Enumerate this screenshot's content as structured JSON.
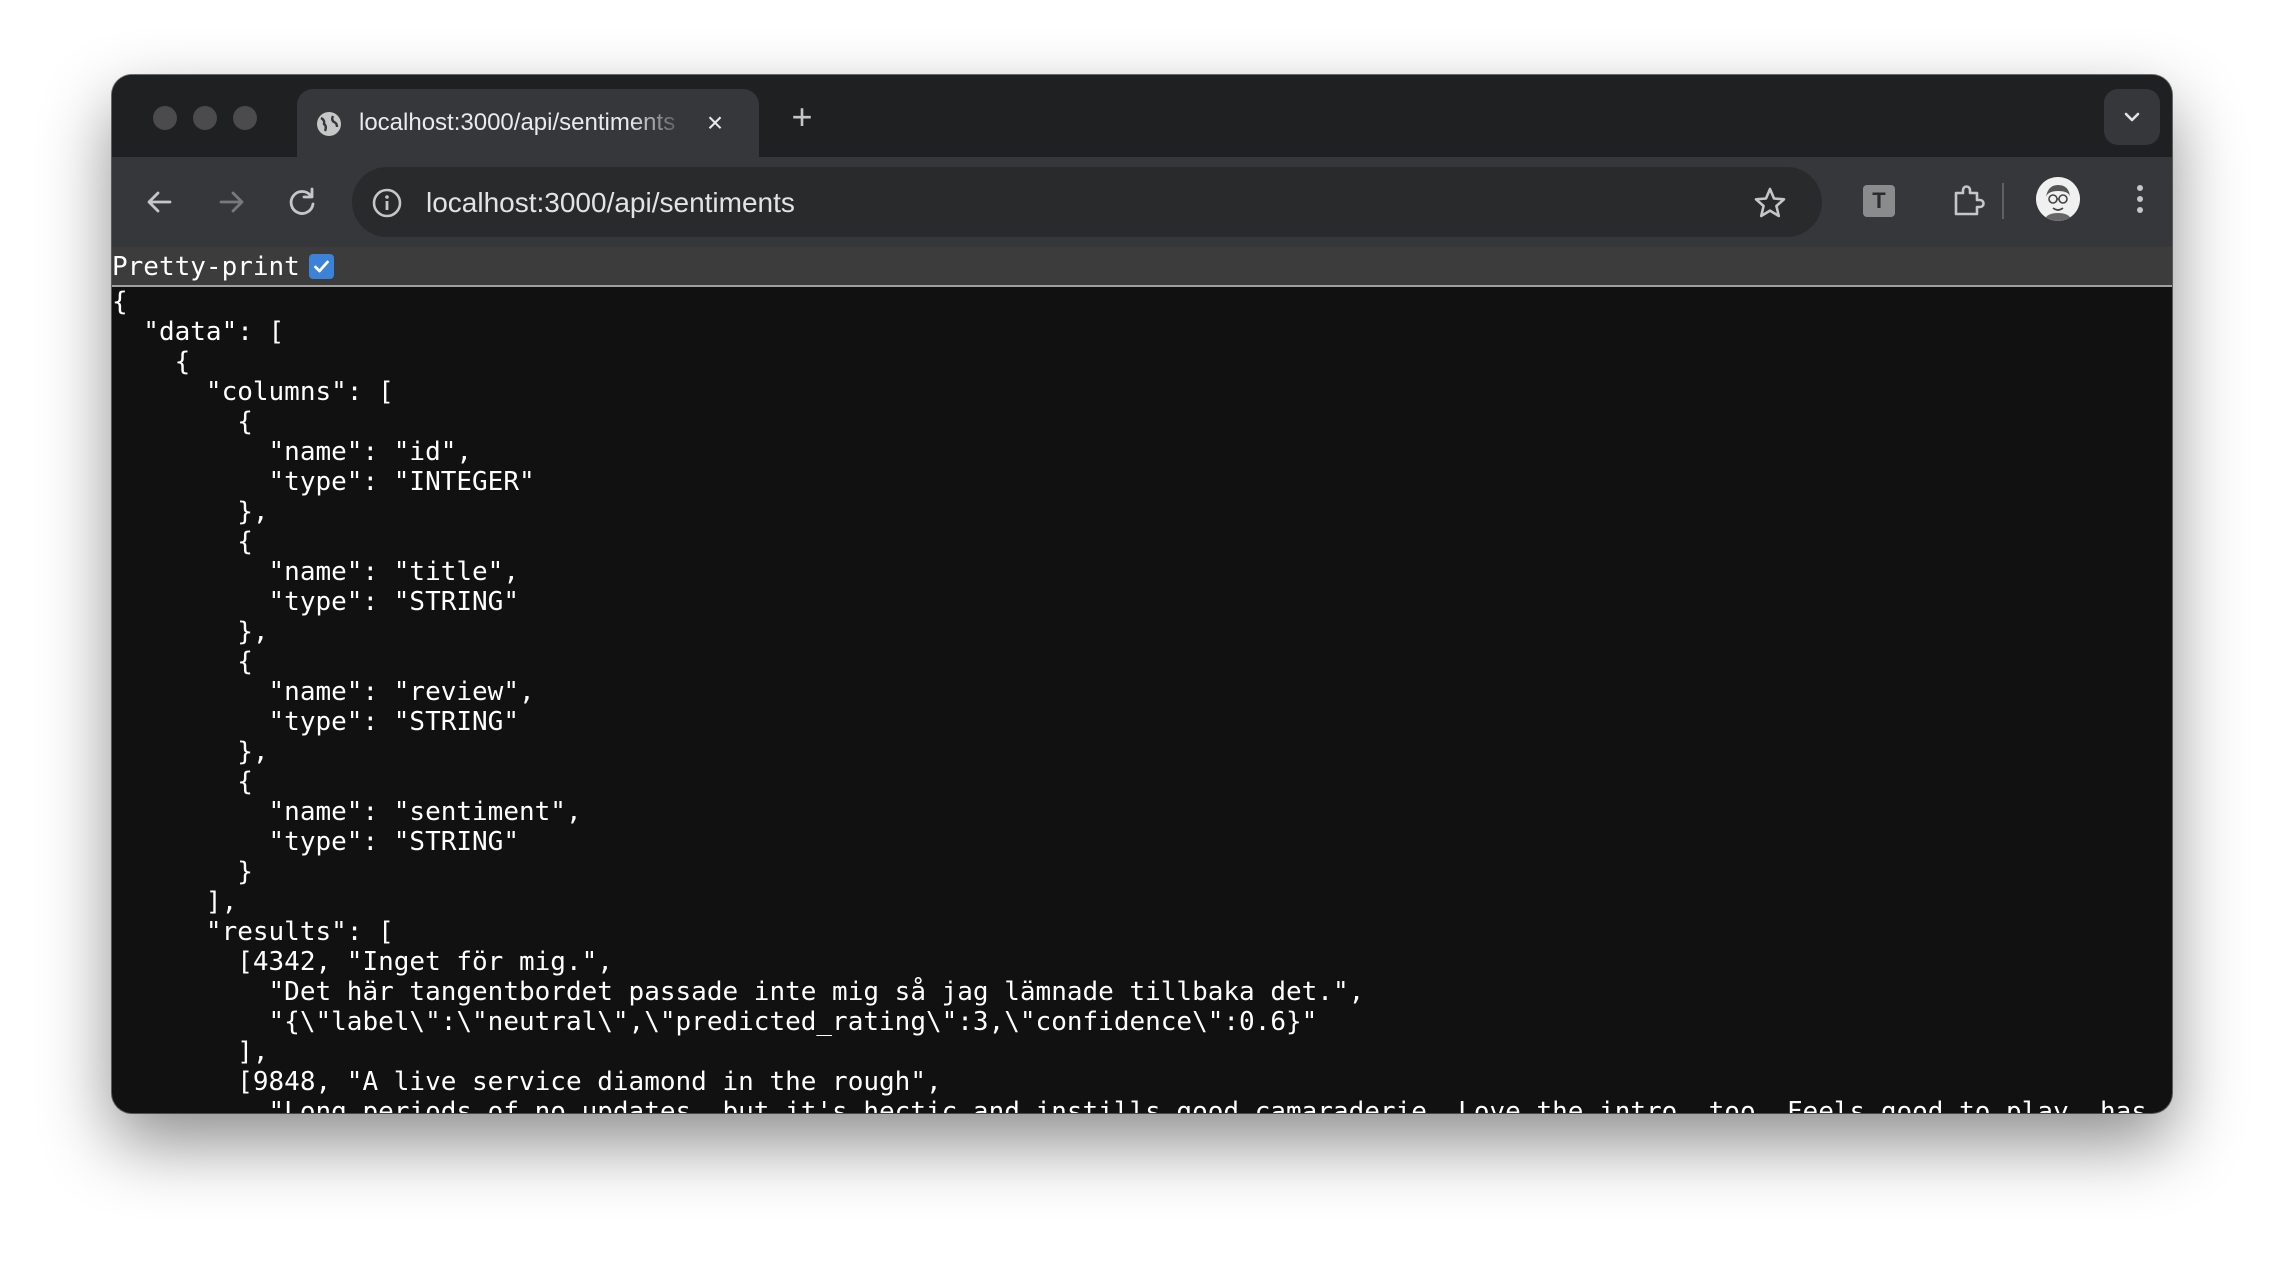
{
  "browser": {
    "tab": {
      "title": "localhost:3000/api/sentiments",
      "close_glyph": "×"
    },
    "new_tab_glyph": "+",
    "omnibox": {
      "url": "localhost:3000/api/sentiments"
    },
    "extension_t_label": "T",
    "icons": [
      "globe-icon",
      "close-icon",
      "plus-icon",
      "chevron-down-icon",
      "back-arrow-icon",
      "forward-arrow-icon",
      "reload-icon",
      "info-icon",
      "star-icon",
      "puzzle-icon",
      "avatar",
      "more-vert-icon",
      "checkbox-check-icon"
    ]
  },
  "pretty_print": {
    "label": "Pretty-print",
    "checked": true
  },
  "json_lines": [
    "{",
    "  \"data\": [",
    "    {",
    "      \"columns\": [",
    "        {",
    "          \"name\": \"id\",",
    "          \"type\": \"INTEGER\"",
    "        },",
    "        {",
    "          \"name\": \"title\",",
    "          \"type\": \"STRING\"",
    "        },",
    "        {",
    "          \"name\": \"review\",",
    "          \"type\": \"STRING\"",
    "        },",
    "        {",
    "          \"name\": \"sentiment\",",
    "          \"type\": \"STRING\"",
    "        }",
    "      ],",
    "      \"results\": [",
    "        [4342, \"Inget för mig.\",",
    "          \"Det här tangentbordet passade inte mig så jag lämnade tillbaka det.\",",
    "          \"{\\\"label\\\":\\\"neutral\\\",\\\"predicted_rating\\\":3,\\\"confidence\\\":0.6}\"",
    "        ],",
    "        [9848, \"A live service diamond in the rough\",",
    "          \"Long periods of no updates, but it's hectic and instills good camaraderie. Love the intro, too. Feels good to play, has"
  ],
  "colors": {
    "window_bg": "#111111",
    "titlebar": "#1f2022",
    "toolbar": "#36373a",
    "omnibox": "#282a2c",
    "checkbox": "#3b82d8"
  }
}
